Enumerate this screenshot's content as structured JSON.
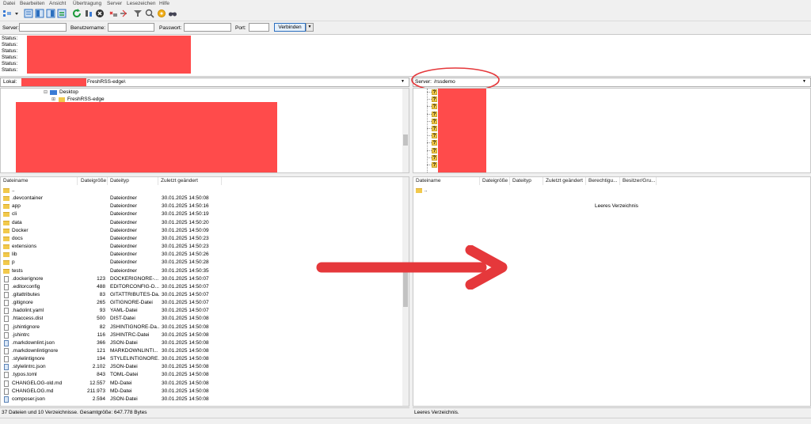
{
  "menu": [
    "Datei",
    "Bearbeiten",
    "Ansicht",
    "Übertragung",
    "Server",
    "Lesezeichen",
    "Hilfe"
  ],
  "toolbar": {
    "icons": [
      "site-manager-icon",
      "message-log-icon",
      "local-tree-icon",
      "remote-tree-icon",
      "queue-icon",
      "refresh-icon",
      "process-queue-icon",
      "cancel-icon",
      "disconnect-icon",
      "reconnect-icon",
      "filter-icon",
      "compare-icon",
      "sync-browse-icon",
      "search-icon"
    ]
  },
  "quickconnect": {
    "server_label": "Server:",
    "user_label": "Benutzername:",
    "pass_label": "Passwort:",
    "port_label": "Port:",
    "connect_label": "Verbinden",
    "dropdown_glyph": "▼"
  },
  "log": {
    "rows": [
      "Status:",
      "Status:",
      "Status:",
      "Status:",
      "Status:",
      "Status:"
    ]
  },
  "local": {
    "path_label": "Lokal:",
    "path_value": "FreshRSS-edge\\",
    "tree": [
      {
        "label": "Desktop",
        "toggle": "⊟"
      },
      {
        "label": "FreshRSS-edge",
        "toggle": "⊞"
      }
    ],
    "columns": [
      "Dateiname",
      "Dateigröße",
      "Dateityp",
      "Zuletzt geändert"
    ],
    "files": [
      {
        "name": "..",
        "size": "",
        "type": "",
        "modified": "",
        "icon": "folder"
      },
      {
        "name": ".devcontainer",
        "size": "",
        "type": "Dateiordner",
        "modified": "30.01.2025 14:50:08",
        "icon": "folder"
      },
      {
        "name": "app",
        "size": "",
        "type": "Dateiordner",
        "modified": "30.01.2025 14:50:16",
        "icon": "folder"
      },
      {
        "name": "cli",
        "size": "",
        "type": "Dateiordner",
        "modified": "30.01.2025 14:50:19",
        "icon": "folder"
      },
      {
        "name": "data",
        "size": "",
        "type": "Dateiordner",
        "modified": "30.01.2025 14:50:20",
        "icon": "folder"
      },
      {
        "name": "Docker",
        "size": "",
        "type": "Dateiordner",
        "modified": "30.01.2025 14:50:09",
        "icon": "folder"
      },
      {
        "name": "docs",
        "size": "",
        "type": "Dateiordner",
        "modified": "30.01.2025 14:50:23",
        "icon": "folder"
      },
      {
        "name": "extensions",
        "size": "",
        "type": "Dateiordner",
        "modified": "30.01.2025 14:50:23",
        "icon": "folder"
      },
      {
        "name": "lib",
        "size": "",
        "type": "Dateiordner",
        "modified": "30.01.2025 14:50:26",
        "icon": "folder"
      },
      {
        "name": "p",
        "size": "",
        "type": "Dateiordner",
        "modified": "30.01.2025 14:50:28",
        "icon": "folder"
      },
      {
        "name": "tests",
        "size": "",
        "type": "Dateiordner",
        "modified": "30.01.2025 14:50:35",
        "icon": "folder"
      },
      {
        "name": ".dockerignore",
        "size": "123",
        "type": "DOCKERIGNORE-...",
        "modified": "30.01.2025 14:50:07",
        "icon": "file"
      },
      {
        "name": ".editorconfig",
        "size": "488",
        "type": "EDITORCONFIG-D...",
        "modified": "30.01.2025 14:50:07",
        "icon": "file"
      },
      {
        "name": ".gitattributes",
        "size": "83",
        "type": "GITATTRIBUTES-Da...",
        "modified": "30.01.2025 14:50:07",
        "icon": "file"
      },
      {
        "name": ".gitignore",
        "size": "265",
        "type": "GITIGNORE-Datei",
        "modified": "30.01.2025 14:50:07",
        "icon": "file"
      },
      {
        "name": ".hadolint.yaml",
        "size": "93",
        "type": "YAML-Datei",
        "modified": "30.01.2025 14:50:07",
        "icon": "file"
      },
      {
        "name": ".htaccess.dist",
        "size": "500",
        "type": "DIST-Datei",
        "modified": "30.01.2025 14:50:08",
        "icon": "file"
      },
      {
        "name": ".jshintignore",
        "size": "82",
        "type": "JSHINTIGNORE-Da...",
        "modified": "30.01.2025 14:50:08",
        "icon": "file"
      },
      {
        "name": ".jshintrc",
        "size": "116",
        "type": "JSHINTRC-Datei",
        "modified": "30.01.2025 14:50:08",
        "icon": "file"
      },
      {
        "name": ".markdownlint.json",
        "size": "366",
        "type": "JSON-Datei",
        "modified": "30.01.2025 14:50:08",
        "icon": "json"
      },
      {
        "name": ".markdownlintignore",
        "size": "121",
        "type": "MARKDOWNLINTI...",
        "modified": "30.01.2025 14:50:08",
        "icon": "file"
      },
      {
        "name": ".stylelintignore",
        "size": "194",
        "type": "STYLELINTIGNORE...",
        "modified": "30.01.2025 14:50:08",
        "icon": "file"
      },
      {
        "name": ".stylelintrc.json",
        "size": "2.102",
        "type": "JSON-Datei",
        "modified": "30.01.2025 14:50:08",
        "icon": "json"
      },
      {
        "name": ".typos.toml",
        "size": "843",
        "type": "TOML-Datei",
        "modified": "30.01.2025 14:50:08",
        "icon": "file"
      },
      {
        "name": "CHANGELOG-old.md",
        "size": "12.557",
        "type": "MD-Datei",
        "modified": "30.01.2025 14:50:08",
        "icon": "file"
      },
      {
        "name": "CHANGELOG.md",
        "size": "211.973",
        "type": "MD-Datei",
        "modified": "30.01.2025 14:50:08",
        "icon": "file"
      },
      {
        "name": "composer.json",
        "size": "2.594",
        "type": "JSON-Datei",
        "modified": "30.01.2025 14:50:08",
        "icon": "json"
      }
    ],
    "status": "37 Dateien und 10 Verzeichnisse. Gesamtgröße: 647.778 Bytes"
  },
  "remote": {
    "path_label": "Server:",
    "path_value": "/rssdemo",
    "tree_marker": "?",
    "columns": [
      "Dateiname",
      "Dateigröße",
      "Dateityp",
      "Zuletzt geändert",
      "Berechtigu...",
      "Besitzer/Gru..."
    ],
    "parent_entry": "..",
    "empty_text": "Leeres Verzeichnis",
    "status": "Leeres Verzeichnis."
  },
  "colors": {
    "redaction": "#ff4b4b",
    "annotation": "#e5383b",
    "folder": "#f2c94c",
    "connect_border": "#2c6fbf"
  }
}
